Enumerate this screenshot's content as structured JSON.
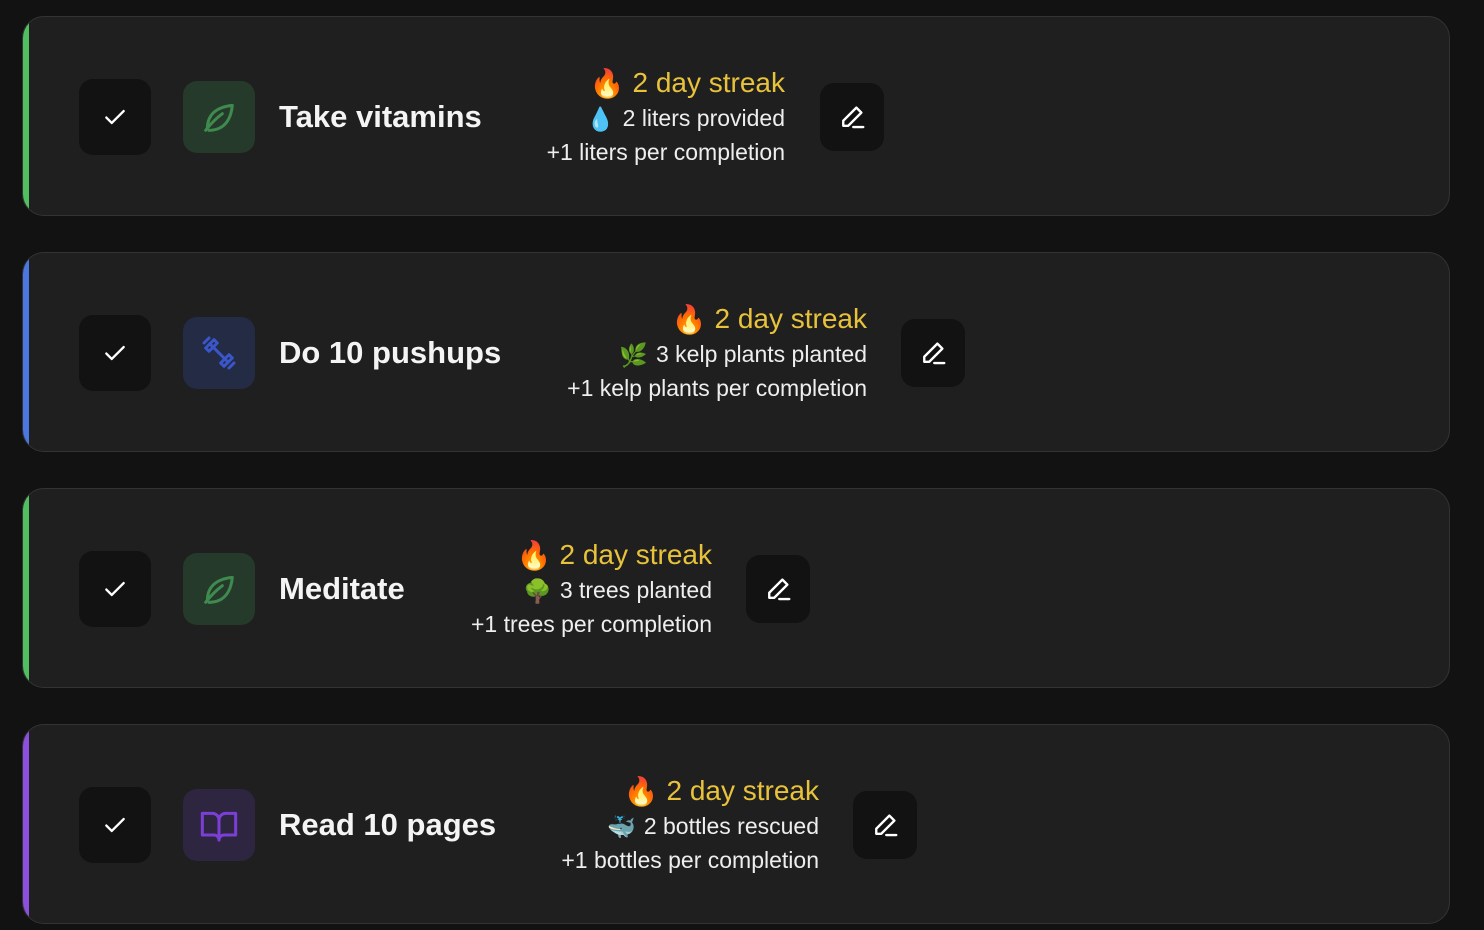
{
  "colors": {
    "background": "#121212",
    "card": "#1f1f1f",
    "streak_text": "#e8c23a"
  },
  "habits": [
    {
      "name": "Take vitamins",
      "icon": "leaf-icon",
      "accent_color": "#4fbf5f",
      "icon_bg": "#253a2a",
      "icon_color": "#3f8a4e",
      "streak_emoji": "🔥",
      "streak_text": "2 day streak",
      "impact_emoji": "💧",
      "impact_text": "2 liters provided",
      "rate_text": "+1 liters per completion"
    },
    {
      "name": "Do 10 pushups",
      "icon": "dumbbell-icon",
      "accent_color": "#4a78e0",
      "icon_bg": "#232b45",
      "icon_color": "#3a56c8",
      "streak_emoji": "🔥",
      "streak_text": "2 day streak",
      "impact_emoji": "🌿",
      "impact_text": "3 kelp plants planted",
      "rate_text": "+1 kelp plants per completion"
    },
    {
      "name": "Meditate",
      "icon": "leaf-icon",
      "accent_color": "#4fbf5f",
      "icon_bg": "#253a2a",
      "icon_color": "#3f8a4e",
      "streak_emoji": "🔥",
      "streak_text": "2 day streak",
      "impact_emoji": "🌳",
      "impact_text": "3 trees planted",
      "rate_text": "+1 trees per completion"
    },
    {
      "name": "Read 10 pages",
      "icon": "book-icon",
      "accent_color": "#8c4fe0",
      "icon_bg": "#2e2540",
      "icon_color": "#7b3fd6",
      "streak_emoji": "🔥",
      "streak_text": "2 day streak",
      "impact_emoji": "🐳",
      "impact_text": "2 bottles rescued",
      "rate_text": "+1 bottles per completion"
    }
  ]
}
